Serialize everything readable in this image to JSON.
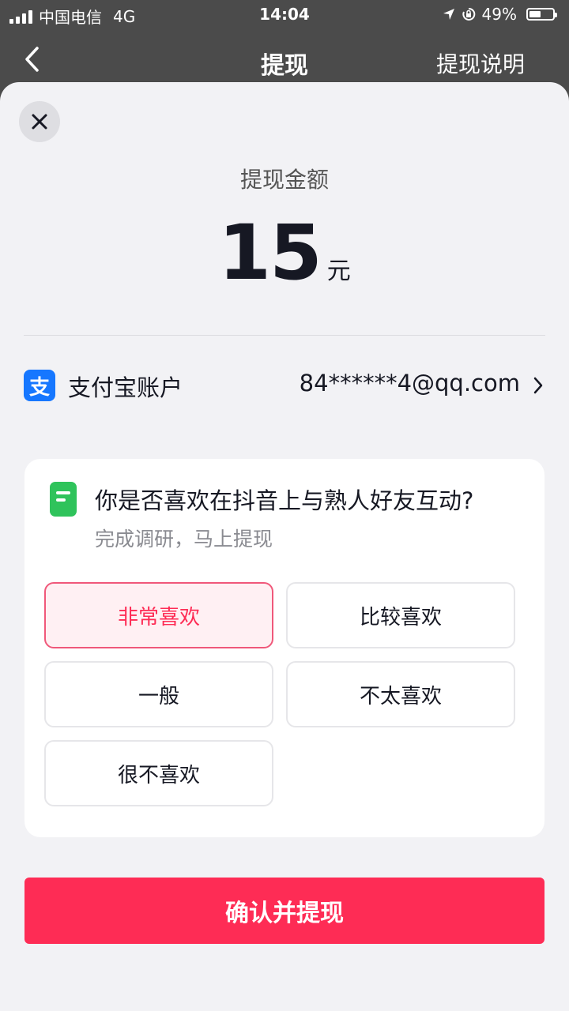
{
  "status_bar": {
    "carrier": "中国电信",
    "network": "4G",
    "time": "14:04",
    "battery": "49%",
    "battery_level": 0.49
  },
  "nav": {
    "title": "提现",
    "right_link": "提现说明"
  },
  "withdraw": {
    "amount_label": "提现金额",
    "amount": "15",
    "unit": "元"
  },
  "account": {
    "icon_text": "支",
    "label": "支付宝账户",
    "email": "84******4@qq.com"
  },
  "survey": {
    "question": "你是否喜欢在抖音上与熟人好友互动?",
    "subtitle": "完成调研，马上提现",
    "options": [
      "非常喜欢",
      "比较喜欢",
      "一般",
      "不太喜欢",
      "很不喜欢"
    ],
    "selected": "非常喜欢"
  },
  "confirm_button": "确认并提现",
  "colors": {
    "accent": "#fe2c55",
    "alipay": "#1677ff",
    "survey_icon": "#2fc35b"
  }
}
